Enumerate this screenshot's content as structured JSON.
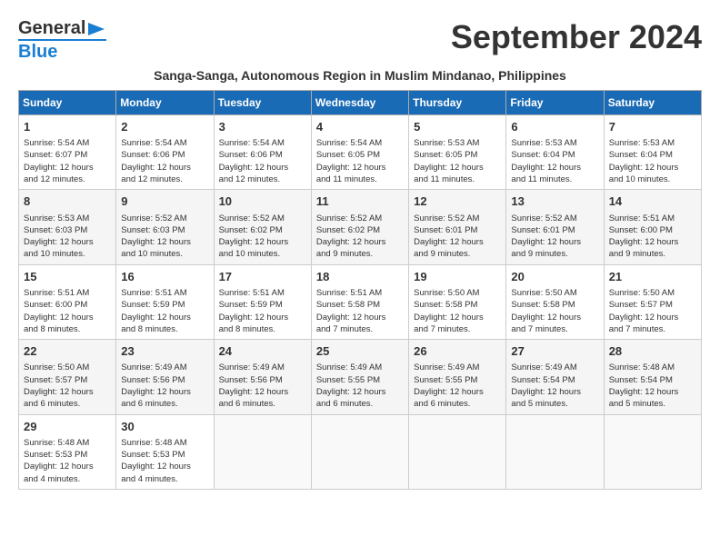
{
  "header": {
    "logo_general": "General",
    "logo_blue": "Blue",
    "month_title": "September 2024",
    "subtitle": "Sanga-Sanga, Autonomous Region in Muslim Mindanao, Philippines"
  },
  "calendar": {
    "days_of_week": [
      "Sunday",
      "Monday",
      "Tuesday",
      "Wednesday",
      "Thursday",
      "Friday",
      "Saturday"
    ],
    "weeks": [
      [
        {
          "day": "",
          "info": ""
        },
        {
          "day": "2",
          "info": "Sunrise: 5:54 AM\nSunset: 6:06 PM\nDaylight: 12 hours\nand 12 minutes."
        },
        {
          "day": "3",
          "info": "Sunrise: 5:54 AM\nSunset: 6:06 PM\nDaylight: 12 hours\nand 12 minutes."
        },
        {
          "day": "4",
          "info": "Sunrise: 5:54 AM\nSunset: 6:05 PM\nDaylight: 12 hours\nand 11 minutes."
        },
        {
          "day": "5",
          "info": "Sunrise: 5:53 AM\nSunset: 6:05 PM\nDaylight: 12 hours\nand 11 minutes."
        },
        {
          "day": "6",
          "info": "Sunrise: 5:53 AM\nSunset: 6:04 PM\nDaylight: 12 hours\nand 11 minutes."
        },
        {
          "day": "7",
          "info": "Sunrise: 5:53 AM\nSunset: 6:04 PM\nDaylight: 12 hours\nand 10 minutes."
        }
      ],
      [
        {
          "day": "1",
          "info": "Sunrise: 5:54 AM\nSunset: 6:07 PM\nDaylight: 12 hours\nand 12 minutes.",
          "row_start": true
        },
        {
          "day": "8",
          "info": "Sunrise: 5:53 AM\nSunset: 6:03 PM\nDaylight: 12 hours\nand 10 minutes."
        },
        {
          "day": "9",
          "info": "Sunrise: 5:52 AM\nSunset: 6:03 PM\nDaylight: 12 hours\nand 10 minutes."
        },
        {
          "day": "10",
          "info": "Sunrise: 5:52 AM\nSunset: 6:02 PM\nDaylight: 12 hours\nand 10 minutes."
        },
        {
          "day": "11",
          "info": "Sunrise: 5:52 AM\nSunset: 6:02 PM\nDaylight: 12 hours\nand 9 minutes."
        },
        {
          "day": "12",
          "info": "Sunrise: 5:52 AM\nSunset: 6:01 PM\nDaylight: 12 hours\nand 9 minutes."
        },
        {
          "day": "13",
          "info": "Sunrise: 5:52 AM\nSunset: 6:01 PM\nDaylight: 12 hours\nand 9 minutes."
        },
        {
          "day": "14",
          "info": "Sunrise: 5:51 AM\nSunset: 6:00 PM\nDaylight: 12 hours\nand 9 minutes."
        }
      ],
      [
        {
          "day": "15",
          "info": "Sunrise: 5:51 AM\nSunset: 6:00 PM\nDaylight: 12 hours\nand 8 minutes."
        },
        {
          "day": "16",
          "info": "Sunrise: 5:51 AM\nSunset: 5:59 PM\nDaylight: 12 hours\nand 8 minutes."
        },
        {
          "day": "17",
          "info": "Sunrise: 5:51 AM\nSunset: 5:59 PM\nDaylight: 12 hours\nand 8 minutes."
        },
        {
          "day": "18",
          "info": "Sunrise: 5:51 AM\nSunset: 5:58 PM\nDaylight: 12 hours\nand 7 minutes."
        },
        {
          "day": "19",
          "info": "Sunrise: 5:50 AM\nSunset: 5:58 PM\nDaylight: 12 hours\nand 7 minutes."
        },
        {
          "day": "20",
          "info": "Sunrise: 5:50 AM\nSunset: 5:58 PM\nDaylight: 12 hours\nand 7 minutes."
        },
        {
          "day": "21",
          "info": "Sunrise: 5:50 AM\nSunset: 5:57 PM\nDaylight: 12 hours\nand 7 minutes."
        }
      ],
      [
        {
          "day": "22",
          "info": "Sunrise: 5:50 AM\nSunset: 5:57 PM\nDaylight: 12 hours\nand 6 minutes."
        },
        {
          "day": "23",
          "info": "Sunrise: 5:49 AM\nSunset: 5:56 PM\nDaylight: 12 hours\nand 6 minutes."
        },
        {
          "day": "24",
          "info": "Sunrise: 5:49 AM\nSunset: 5:56 PM\nDaylight: 12 hours\nand 6 minutes."
        },
        {
          "day": "25",
          "info": "Sunrise: 5:49 AM\nSunset: 5:55 PM\nDaylight: 12 hours\nand 6 minutes."
        },
        {
          "day": "26",
          "info": "Sunrise: 5:49 AM\nSunset: 5:55 PM\nDaylight: 12 hours\nand 6 minutes."
        },
        {
          "day": "27",
          "info": "Sunrise: 5:49 AM\nSunset: 5:54 PM\nDaylight: 12 hours\nand 5 minutes."
        },
        {
          "day": "28",
          "info": "Sunrise: 5:48 AM\nSunset: 5:54 PM\nDaylight: 12 hours\nand 5 minutes."
        }
      ],
      [
        {
          "day": "29",
          "info": "Sunrise: 5:48 AM\nSunset: 5:53 PM\nDaylight: 12 hours\nand 4 minutes."
        },
        {
          "day": "30",
          "info": "Sunrise: 5:48 AM\nSunset: 5:53 PM\nDaylight: 12 hours\nand 4 minutes."
        },
        {
          "day": "",
          "info": ""
        },
        {
          "day": "",
          "info": ""
        },
        {
          "day": "",
          "info": ""
        },
        {
          "day": "",
          "info": ""
        },
        {
          "day": "",
          "info": ""
        }
      ]
    ]
  }
}
